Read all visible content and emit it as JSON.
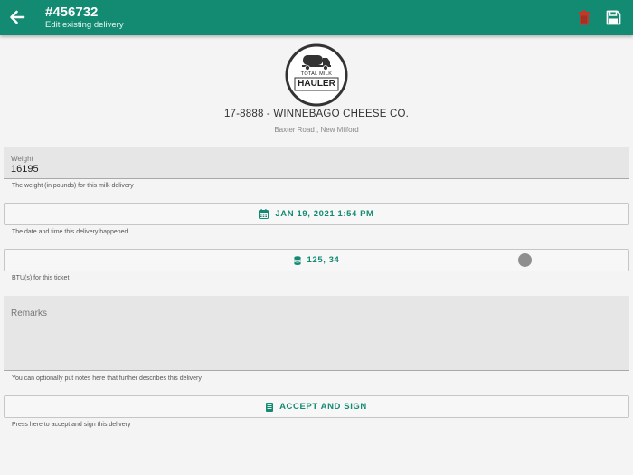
{
  "header": {
    "title": "#456732",
    "subtitle": "Edit existing delivery",
    "back_icon": "arrow-left-icon",
    "delete_icon": "trash-icon",
    "save_icon": "floppy-disk-icon",
    "bar_color": "#138a72",
    "delete_color": "#c0392b"
  },
  "logo": {
    "line1": "TOTAL MILK",
    "line2": "HAULER",
    "icon": "milk-truck-icon"
  },
  "supplier": {
    "name": "17-8888 - WINNEBAGO CHEESE CO.",
    "address": "Baxter Road , New Milford"
  },
  "weight": {
    "label": "Weight",
    "value": "16195",
    "help": "The weight (in pounds) for this milk delivery"
  },
  "datetime": {
    "value": "JAN 19, 2021 1:54 PM",
    "icon": "calendar-icon",
    "help": "The date and time this delivery happened."
  },
  "btu": {
    "value": "125, 34",
    "icon": "database-icon",
    "help": "BTU(s) for this ticket"
  },
  "remarks": {
    "placeholder": "Remarks",
    "help": "You can optionally put notes here that further describes this delivery"
  },
  "accept": {
    "label": "ACCEPT AND SIGN",
    "icon": "document-icon",
    "help": "Press here to accept and sign this delivery"
  },
  "accent_color": "#138a72"
}
